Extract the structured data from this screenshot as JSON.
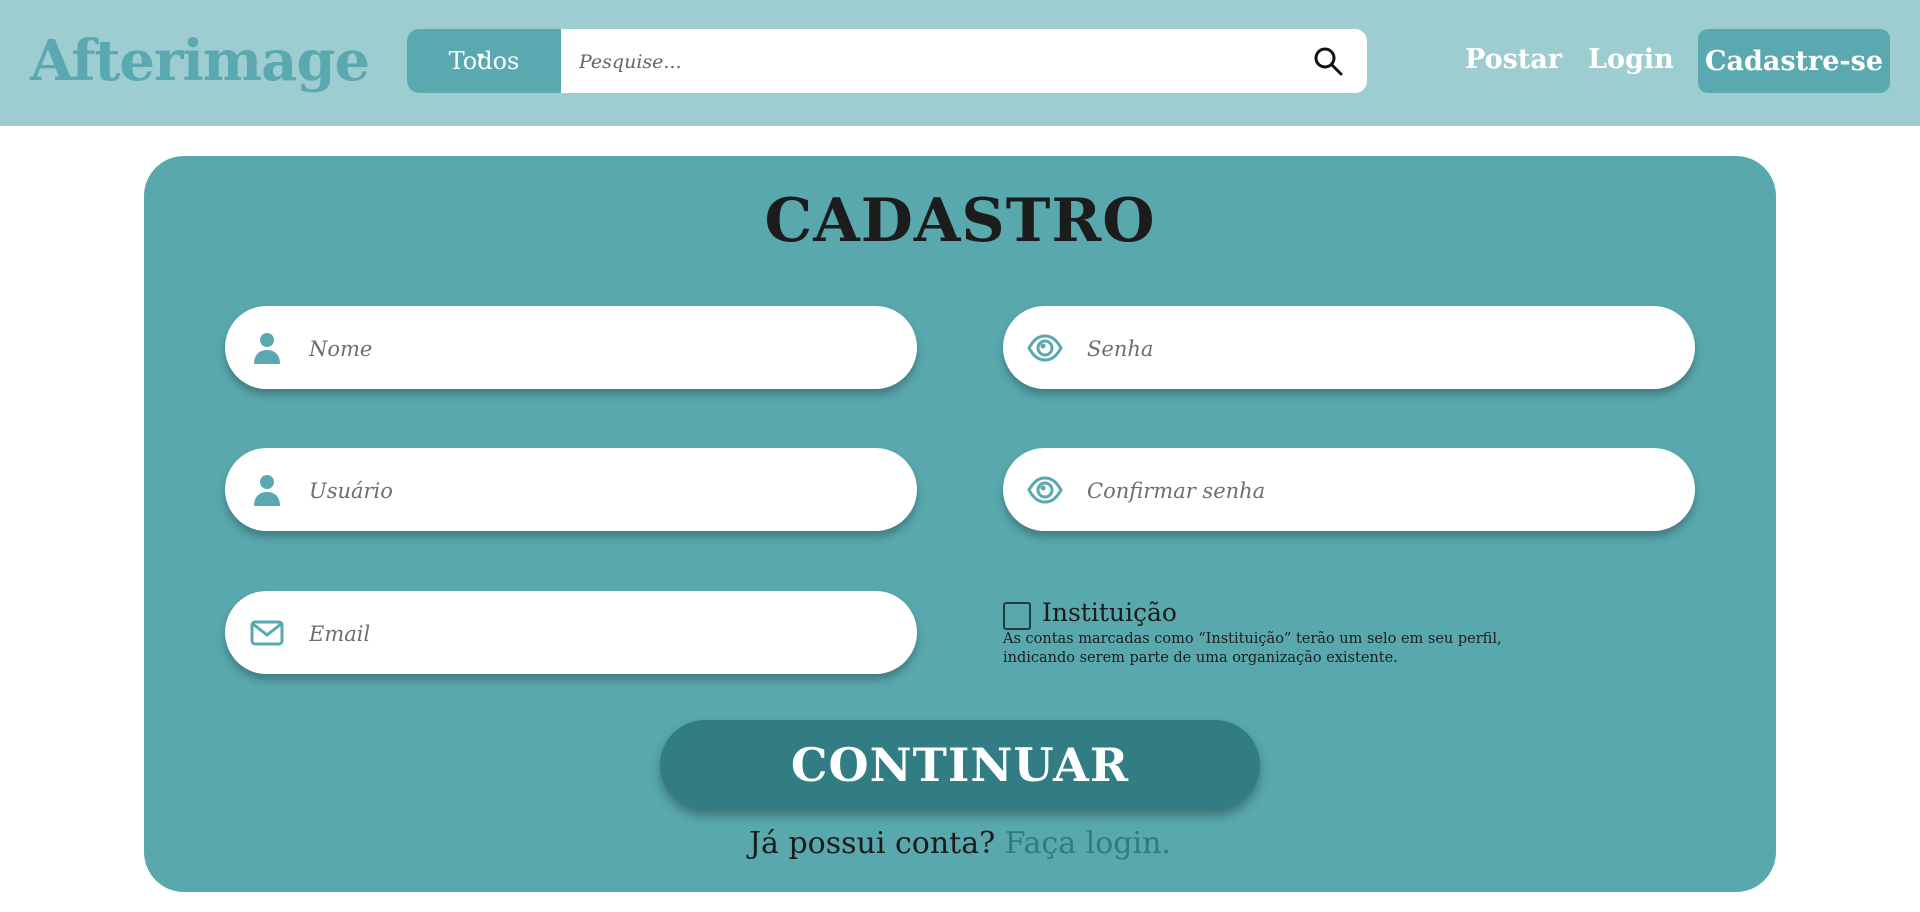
{
  "header": {
    "logo": "Afterimage",
    "search_category": "Todos",
    "search_placeholder": "Pesquise...",
    "nav": {
      "post": "Postar",
      "login": "Login",
      "signup": "Cadastre-se"
    }
  },
  "form": {
    "title": "CADASTRO",
    "fields": {
      "name_placeholder": "Nome",
      "user_placeholder": "Usuário",
      "email_placeholder": "Email",
      "password_placeholder": "Senha",
      "confirm_placeholder": "Confirmar senha"
    },
    "institution": {
      "label": "Instituição",
      "checked": false,
      "note": "As contas marcadas como “Instituição” terão um selo em seu perfil, indicando serem parte de uma organização existente."
    },
    "continue_label": "CONTINUAR",
    "login_prompt": "Já possui conta?",
    "login_link": "Faça login."
  },
  "colors": {
    "header_bg": "#9dcdd0",
    "accent": "#5aa9b0",
    "card_bg": "#58a8ae",
    "button_dark": "#317d83"
  },
  "icons": [
    "search-icon",
    "user-icon",
    "email-icon",
    "eye-icon",
    "chevron-down-icon"
  ]
}
